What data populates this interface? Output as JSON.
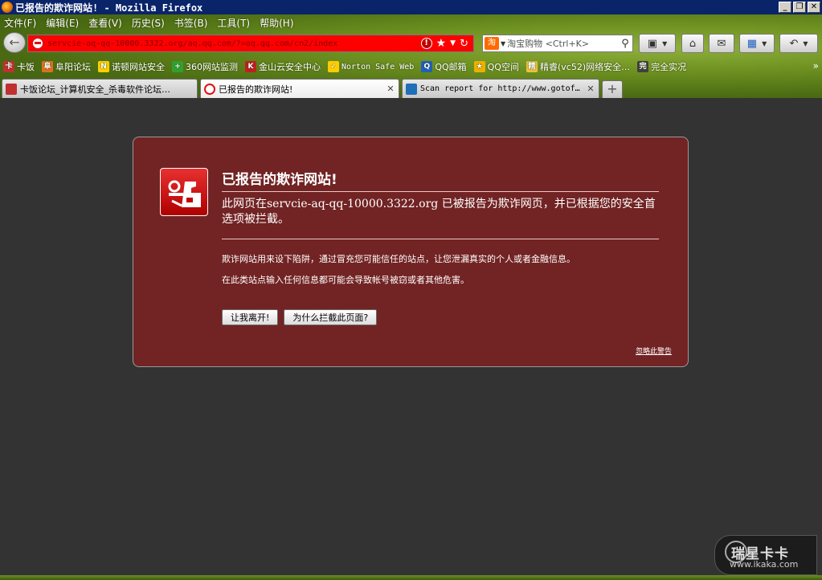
{
  "window": {
    "title": "已报告的欺诈网站! - Mozilla Firefox",
    "controls": [
      "_",
      "❐",
      "✕"
    ]
  },
  "menu": [
    {
      "label": "文件(F)"
    },
    {
      "label": "编辑(E)"
    },
    {
      "label": "查看(V)"
    },
    {
      "label": "历史(S)"
    },
    {
      "label": "书签(B)"
    },
    {
      "label": "工具(T)"
    },
    {
      "label": "帮助(H)"
    }
  ],
  "navbar": {
    "url": "servcie-aq-qq-10000.3322.org/aq.qq.com/?=aq.qq.com/cn2/index",
    "search_placeholder": "淘宝购物 <Ctrl+K>",
    "search_engine_label": "淘",
    "urlbar_color": "#ff0000"
  },
  "bookmarks": [
    {
      "label": "卡饭",
      "icon": "kafan-icon",
      "color": "#c03030",
      "glyph": "卡"
    },
    {
      "label": "阜阳论坛",
      "icon": "fuyang-icon",
      "color": "#e07020",
      "glyph": "阜"
    },
    {
      "label": "诺顿网站安全",
      "icon": "norton-safeweb-icon",
      "color": "#ffd000",
      "glyph": "N"
    },
    {
      "label": "360网站监测",
      "icon": "360-icon",
      "color": "#30a030",
      "glyph": "+"
    },
    {
      "label": "金山云安全中心",
      "icon": "kingsoft-icon",
      "color": "#c02020",
      "glyph": "K"
    },
    {
      "label": "Norton Safe Web",
      "icon": "norton-check-icon",
      "color": "#ffcc00",
      "glyph": "✓"
    },
    {
      "label": "QQ邮箱",
      "icon": "qqmail-icon",
      "color": "#2060c0",
      "glyph": "Q"
    },
    {
      "label": "QQ空间",
      "icon": "qzone-star-icon",
      "color": "#f0b000",
      "glyph": "★"
    },
    {
      "label": "精睿(vc52)网络安全…",
      "icon": "vc52-icon",
      "color": "#f0c040",
      "glyph": "精"
    },
    {
      "label": "完全实况",
      "icon": "pes-icon",
      "color": "#404040",
      "glyph": "完"
    }
  ],
  "tabs": [
    {
      "label": "卡饭论坛_计算机安全_杀毒软件论坛…",
      "icon_color": "#c03030",
      "active": false,
      "mono": false
    },
    {
      "label": "已报告的欺诈网站!",
      "icon_color": "#e01010",
      "active": true,
      "mono": false
    },
    {
      "label": "Scan report for http://www.gotof…",
      "icon_color": "#1e6fb8",
      "active": false,
      "mono": true
    }
  ],
  "error_page": {
    "title": "已报告的欺诈网站!",
    "short_desc_prefix": "此网页在",
    "short_desc_site": "servcie-aq-qq-10000.3322.org",
    "short_desc_suffix": " 已被报告为欺诈网页，并已根据您的安全首选项被拦截。",
    "long_desc_1": "欺诈网站用来设下陷阱，通过冒充您可能信任的站点，让您泄漏真实的个人或者金融信息。",
    "long_desc_2": "在此类站点输入任何信息都可能会导致帐号被窃或者其他危害。",
    "get_me_out": "让我离开!",
    "why_blocked": "为什么拦截此页面?",
    "ignore_warning": "忽略此警告",
    "bg_color": "#722323"
  },
  "watermark": {
    "brand": "瑞星卡卡",
    "site": "www.ikaka.com"
  }
}
